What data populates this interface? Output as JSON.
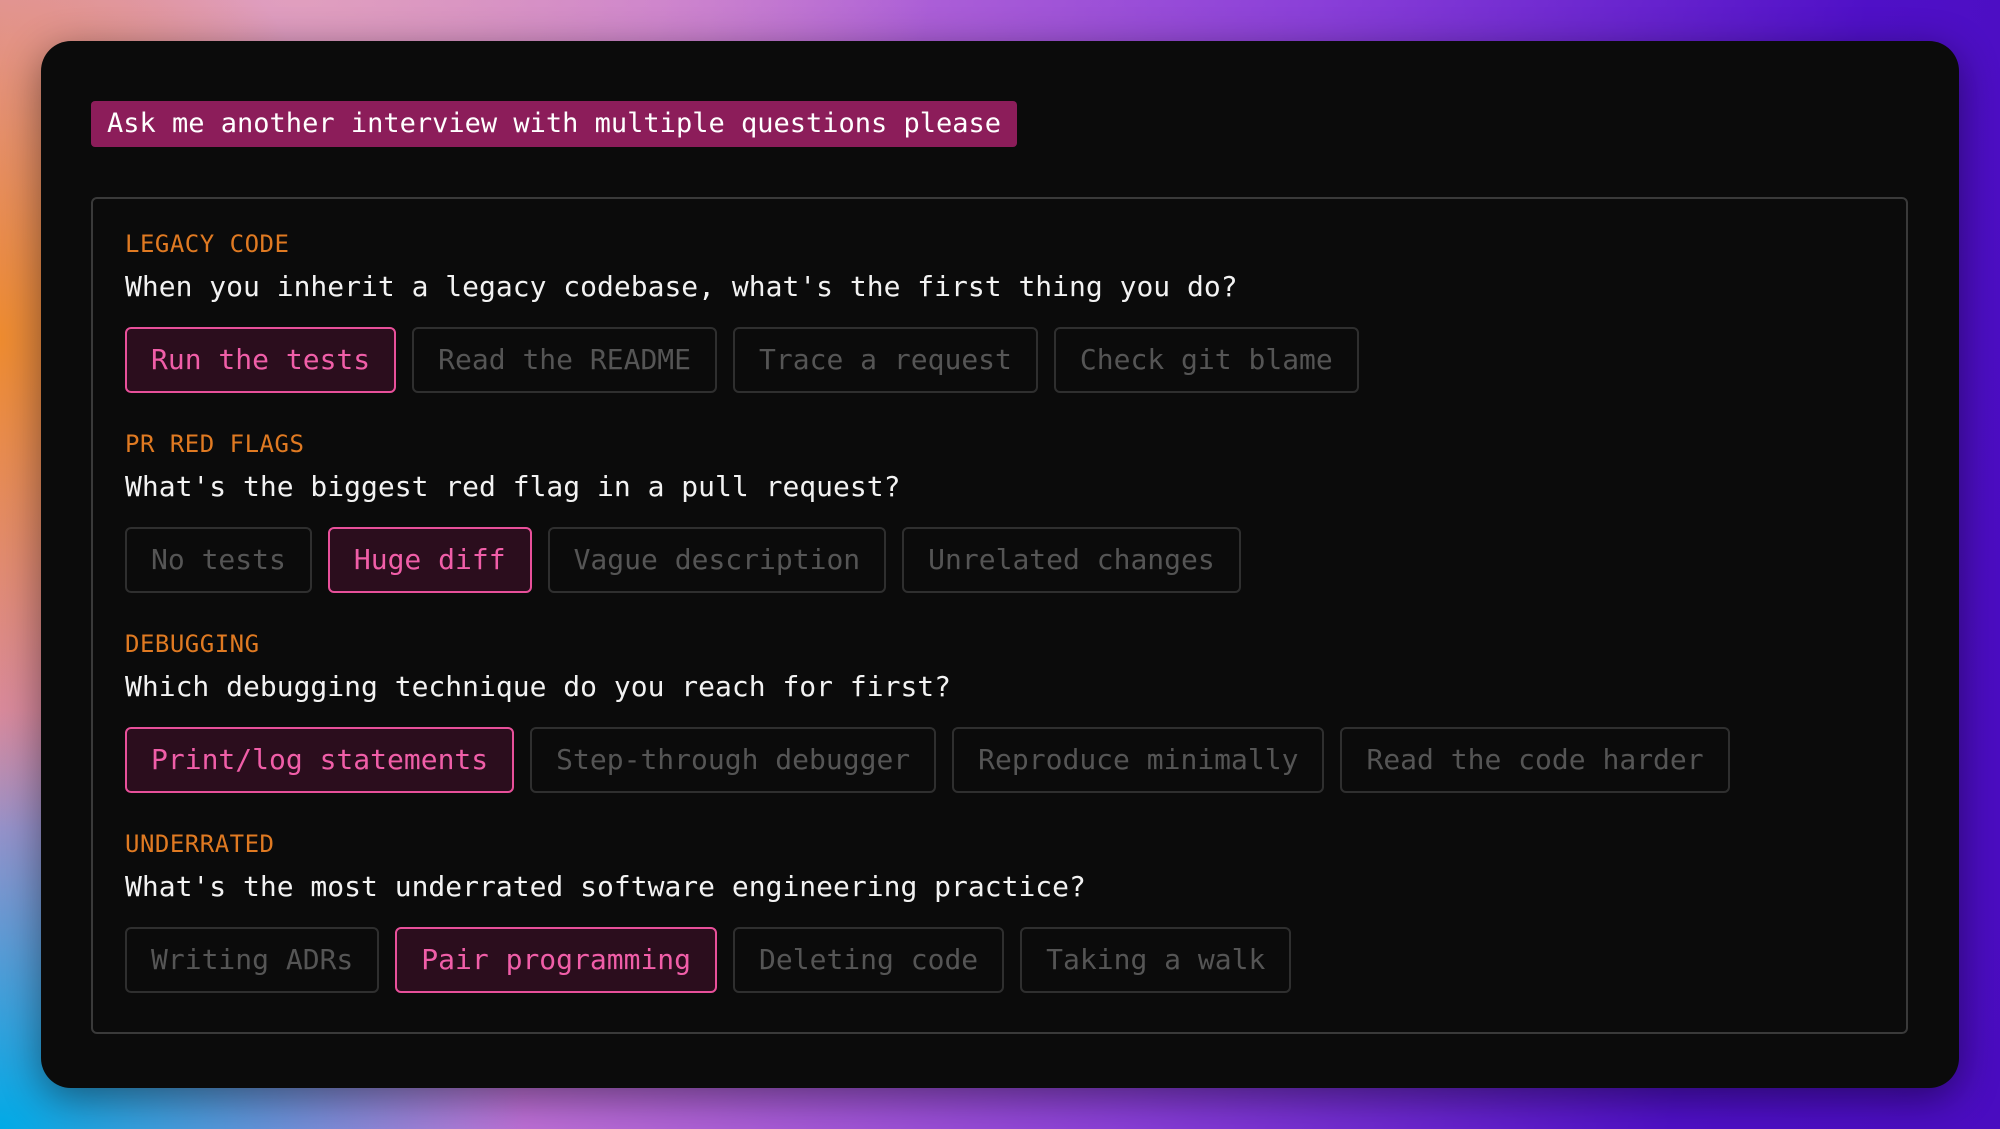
{
  "prompt": "Ask me another interview with multiple questions please",
  "questions": [
    {
      "label": "LEGACY CODE",
      "text": "When you inherit a legacy codebase, what's the first thing you do?",
      "options": [
        "Run the tests",
        "Read the README",
        "Trace a request",
        "Check git blame"
      ],
      "selected": 0
    },
    {
      "label": "PR RED FLAGS",
      "text": "What's the biggest red flag in a pull request?",
      "options": [
        "No tests",
        "Huge diff",
        "Vague description",
        "Unrelated changes"
      ],
      "selected": 1
    },
    {
      "label": "DEBUGGING",
      "text": "Which debugging technique do you reach for first?",
      "options": [
        "Print/log statements",
        "Step-through debugger",
        "Reproduce minimally",
        "Read the code harder"
      ],
      "selected": 0
    },
    {
      "label": "UNDERRATED",
      "text": "What's the most underrated software engineering practice?",
      "options": [
        "Writing ADRs",
        "Pair programming",
        "Deleting code",
        "Taking a walk"
      ],
      "selected": 1
    }
  ],
  "colors": {
    "prompt_bg": "#8c1d5a",
    "label": "#e07a22",
    "selected_border": "#e8509a",
    "selected_text": "#f05ea8",
    "unselected_text": "#555555"
  }
}
